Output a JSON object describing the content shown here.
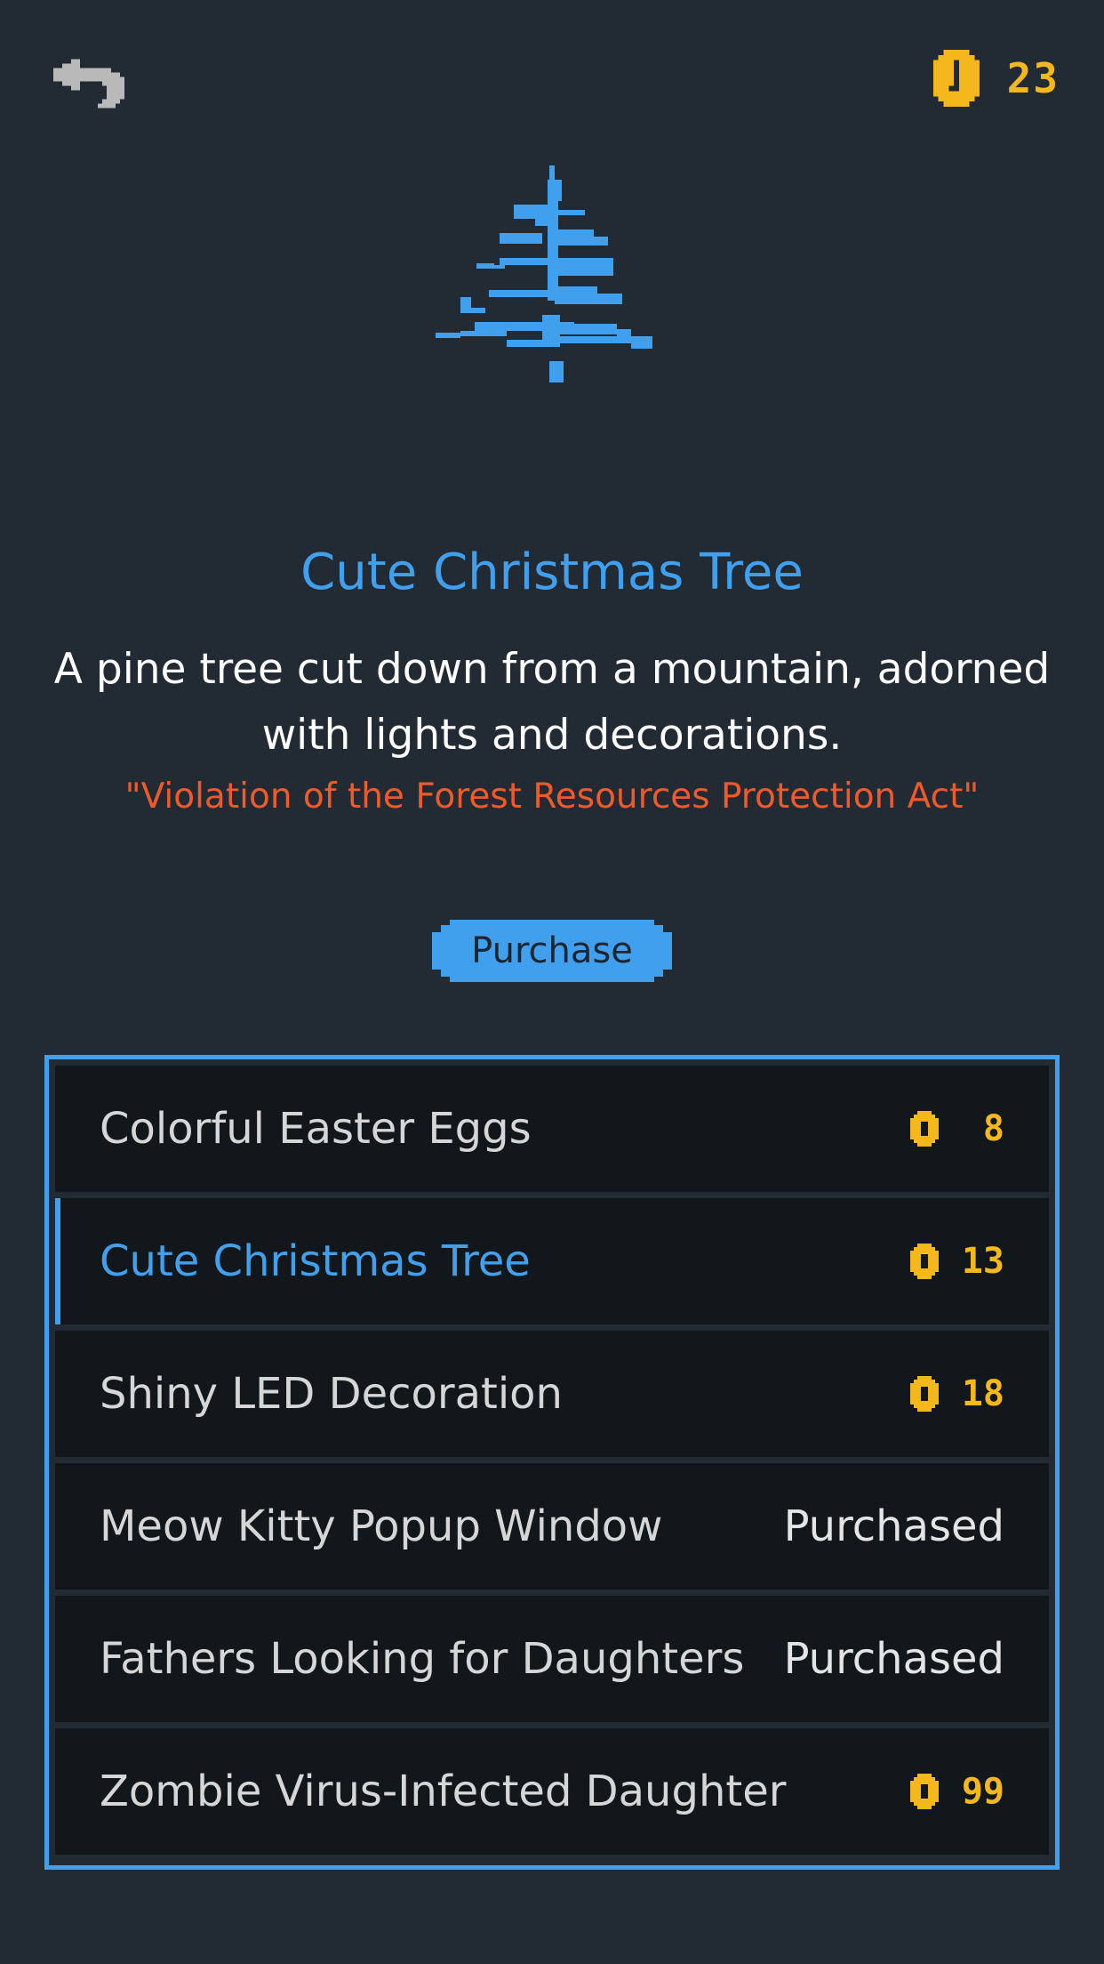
{
  "header": {
    "back_icon": "back-arrow-icon",
    "coin_icon": "coin-icon",
    "coins": "23"
  },
  "item": {
    "title": "Cute Christmas Tree",
    "description": "A pine tree cut down from a mountain, adorned with lights and decorations.",
    "quote": "\"Violation of the Forest Resources Protection Act\"",
    "purchase_label": "Purchase"
  },
  "shop": {
    "items": [
      {
        "name": "Colorful Easter Eggs",
        "price": "8",
        "status": "",
        "selected": false
      },
      {
        "name": "Cute Christmas Tree",
        "price": "13",
        "status": "",
        "selected": true
      },
      {
        "name": "Shiny LED Decoration",
        "price": "18",
        "status": "",
        "selected": false
      },
      {
        "name": "Meow Kitty Popup Window",
        "price": "",
        "status": "Purchased",
        "selected": false
      },
      {
        "name": "Fathers Looking for Daughters",
        "price": "",
        "status": "Purchased",
        "selected": false
      },
      {
        "name": "Zombie Virus-Infected Daughter",
        "price": "99",
        "status": "",
        "selected": false
      }
    ]
  },
  "colors": {
    "background": "#222a34",
    "accent": "#41a0ee",
    "coin": "#f4b81c",
    "warning": "#ef5a2a",
    "row": "#12171c"
  }
}
